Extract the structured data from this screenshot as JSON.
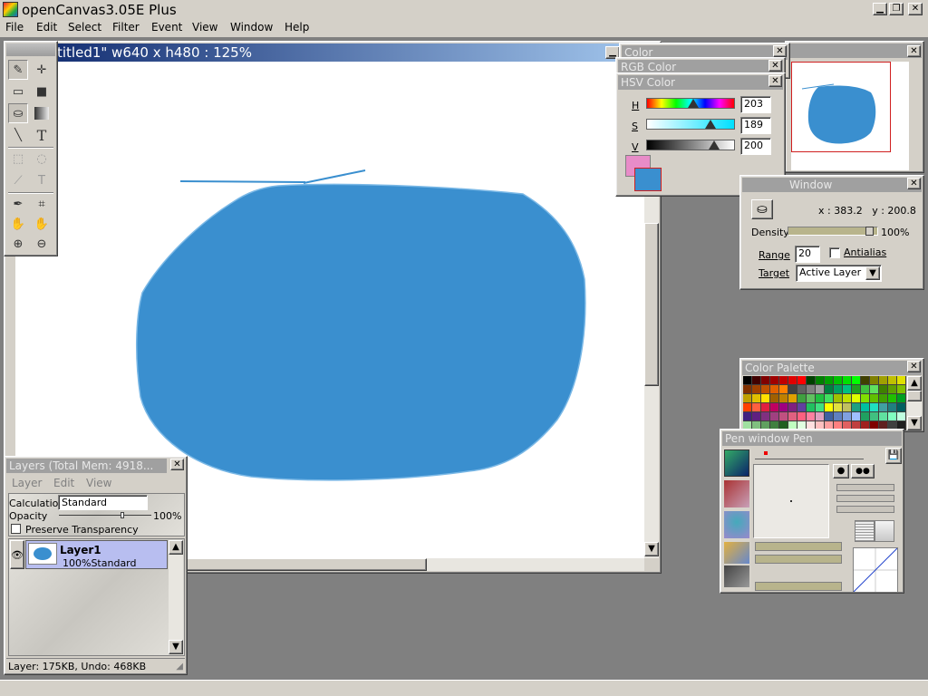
{
  "app": {
    "title": "openCanvas3.05E Plus"
  },
  "menu": [
    "File",
    "Edit",
    "Select",
    "Filter",
    "Event",
    "View",
    "Window",
    "Help"
  ],
  "document": {
    "title": "titled1\" w640 x h480 : 125%"
  },
  "colors": {
    "blob": "#3a8fcf",
    "foreground": "#e88cc8",
    "background": "#3a8fcf"
  },
  "color_panels": {
    "color_title": "Color",
    "rgb_title": "RGB Color",
    "hsv_title": "HSV Color",
    "h_label": "H",
    "h_value": "203",
    "s_label": "S",
    "s_value": "189",
    "v_label": "V",
    "v_value": "200"
  },
  "tool_window": {
    "title": "Window",
    "coords": "x : 383.2   y : 200.8",
    "density_label": "Density",
    "density_value": "100%",
    "range_label": "Range",
    "range_value": "20",
    "antialias_label": "Antialias",
    "target_label": "Target",
    "target_value": "Active Layer"
  },
  "palette": {
    "title": "Color Palette"
  },
  "pen_window": {
    "title": "Pen window   Pen"
  },
  "layers": {
    "title": "Layers (Total Mem: 4918...",
    "menu": [
      "Layer",
      "Edit",
      "View"
    ],
    "calc_label": "Calculation",
    "calc_value": "Standard",
    "opacity_label": "Opacity",
    "opacity_value": "100%",
    "preserve_label": "Preserve Transparency",
    "layer_name": "Layer1",
    "layer_info": "100%Standard",
    "status": "Layer: 175KB, Undo: 468KB"
  }
}
